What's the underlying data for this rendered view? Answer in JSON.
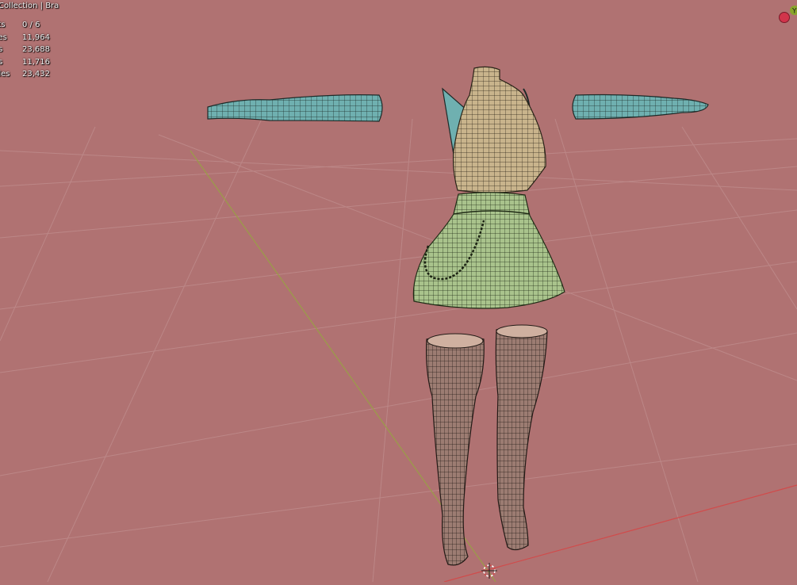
{
  "viewport": {
    "collection_text": "Collection | Bra",
    "stats": [
      {
        "label": "cts",
        "value": "0 / 6"
      },
      {
        "label": "ces",
        "value": "11,964"
      },
      {
        "label": "es",
        "value": "23,688"
      },
      {
        "label": "es",
        "value": "11,716"
      },
      {
        "label": "gles",
        "value": "23,432"
      }
    ],
    "gizmo": {
      "y_axis_label": "Y"
    },
    "colors": {
      "background": "#b07272",
      "grid": "#c08a8a",
      "x_axis": "#d14b4b",
      "y_axis": "#9b9b4a",
      "arms": "#6fb0b0",
      "torso": "#c9b48c",
      "skirt": "#a9c38c",
      "stockings": "#9c7c72"
    }
  }
}
